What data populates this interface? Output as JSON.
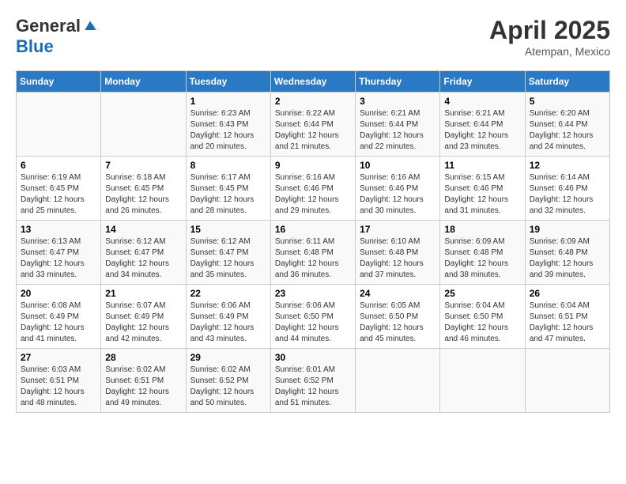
{
  "header": {
    "logo_general": "General",
    "logo_blue": "Blue",
    "month": "April 2025",
    "location": "Atempan, Mexico"
  },
  "days_of_week": [
    "Sunday",
    "Monday",
    "Tuesday",
    "Wednesday",
    "Thursday",
    "Friday",
    "Saturday"
  ],
  "weeks": [
    [
      {
        "day": "",
        "sunrise": "",
        "sunset": "",
        "daylight": ""
      },
      {
        "day": "",
        "sunrise": "",
        "sunset": "",
        "daylight": ""
      },
      {
        "day": "1",
        "sunrise": "Sunrise: 6:23 AM",
        "sunset": "Sunset: 6:43 PM",
        "daylight": "Daylight: 12 hours and 20 minutes."
      },
      {
        "day": "2",
        "sunrise": "Sunrise: 6:22 AM",
        "sunset": "Sunset: 6:44 PM",
        "daylight": "Daylight: 12 hours and 21 minutes."
      },
      {
        "day": "3",
        "sunrise": "Sunrise: 6:21 AM",
        "sunset": "Sunset: 6:44 PM",
        "daylight": "Daylight: 12 hours and 22 minutes."
      },
      {
        "day": "4",
        "sunrise": "Sunrise: 6:21 AM",
        "sunset": "Sunset: 6:44 PM",
        "daylight": "Daylight: 12 hours and 23 minutes."
      },
      {
        "day": "5",
        "sunrise": "Sunrise: 6:20 AM",
        "sunset": "Sunset: 6:44 PM",
        "daylight": "Daylight: 12 hours and 24 minutes."
      }
    ],
    [
      {
        "day": "6",
        "sunrise": "Sunrise: 6:19 AM",
        "sunset": "Sunset: 6:45 PM",
        "daylight": "Daylight: 12 hours and 25 minutes."
      },
      {
        "day": "7",
        "sunrise": "Sunrise: 6:18 AM",
        "sunset": "Sunset: 6:45 PM",
        "daylight": "Daylight: 12 hours and 26 minutes."
      },
      {
        "day": "8",
        "sunrise": "Sunrise: 6:17 AM",
        "sunset": "Sunset: 6:45 PM",
        "daylight": "Daylight: 12 hours and 28 minutes."
      },
      {
        "day": "9",
        "sunrise": "Sunrise: 6:16 AM",
        "sunset": "Sunset: 6:46 PM",
        "daylight": "Daylight: 12 hours and 29 minutes."
      },
      {
        "day": "10",
        "sunrise": "Sunrise: 6:16 AM",
        "sunset": "Sunset: 6:46 PM",
        "daylight": "Daylight: 12 hours and 30 minutes."
      },
      {
        "day": "11",
        "sunrise": "Sunrise: 6:15 AM",
        "sunset": "Sunset: 6:46 PM",
        "daylight": "Daylight: 12 hours and 31 minutes."
      },
      {
        "day": "12",
        "sunrise": "Sunrise: 6:14 AM",
        "sunset": "Sunset: 6:46 PM",
        "daylight": "Daylight: 12 hours and 32 minutes."
      }
    ],
    [
      {
        "day": "13",
        "sunrise": "Sunrise: 6:13 AM",
        "sunset": "Sunset: 6:47 PM",
        "daylight": "Daylight: 12 hours and 33 minutes."
      },
      {
        "day": "14",
        "sunrise": "Sunrise: 6:12 AM",
        "sunset": "Sunset: 6:47 PM",
        "daylight": "Daylight: 12 hours and 34 minutes."
      },
      {
        "day": "15",
        "sunrise": "Sunrise: 6:12 AM",
        "sunset": "Sunset: 6:47 PM",
        "daylight": "Daylight: 12 hours and 35 minutes."
      },
      {
        "day": "16",
        "sunrise": "Sunrise: 6:11 AM",
        "sunset": "Sunset: 6:48 PM",
        "daylight": "Daylight: 12 hours and 36 minutes."
      },
      {
        "day": "17",
        "sunrise": "Sunrise: 6:10 AM",
        "sunset": "Sunset: 6:48 PM",
        "daylight": "Daylight: 12 hours and 37 minutes."
      },
      {
        "day": "18",
        "sunrise": "Sunrise: 6:09 AM",
        "sunset": "Sunset: 6:48 PM",
        "daylight": "Daylight: 12 hours and 38 minutes."
      },
      {
        "day": "19",
        "sunrise": "Sunrise: 6:09 AM",
        "sunset": "Sunset: 6:48 PM",
        "daylight": "Daylight: 12 hours and 39 minutes."
      }
    ],
    [
      {
        "day": "20",
        "sunrise": "Sunrise: 6:08 AM",
        "sunset": "Sunset: 6:49 PM",
        "daylight": "Daylight: 12 hours and 41 minutes."
      },
      {
        "day": "21",
        "sunrise": "Sunrise: 6:07 AM",
        "sunset": "Sunset: 6:49 PM",
        "daylight": "Daylight: 12 hours and 42 minutes."
      },
      {
        "day": "22",
        "sunrise": "Sunrise: 6:06 AM",
        "sunset": "Sunset: 6:49 PM",
        "daylight": "Daylight: 12 hours and 43 minutes."
      },
      {
        "day": "23",
        "sunrise": "Sunrise: 6:06 AM",
        "sunset": "Sunset: 6:50 PM",
        "daylight": "Daylight: 12 hours and 44 minutes."
      },
      {
        "day": "24",
        "sunrise": "Sunrise: 6:05 AM",
        "sunset": "Sunset: 6:50 PM",
        "daylight": "Daylight: 12 hours and 45 minutes."
      },
      {
        "day": "25",
        "sunrise": "Sunrise: 6:04 AM",
        "sunset": "Sunset: 6:50 PM",
        "daylight": "Daylight: 12 hours and 46 minutes."
      },
      {
        "day": "26",
        "sunrise": "Sunrise: 6:04 AM",
        "sunset": "Sunset: 6:51 PM",
        "daylight": "Daylight: 12 hours and 47 minutes."
      }
    ],
    [
      {
        "day": "27",
        "sunrise": "Sunrise: 6:03 AM",
        "sunset": "Sunset: 6:51 PM",
        "daylight": "Daylight: 12 hours and 48 minutes."
      },
      {
        "day": "28",
        "sunrise": "Sunrise: 6:02 AM",
        "sunset": "Sunset: 6:51 PM",
        "daylight": "Daylight: 12 hours and 49 minutes."
      },
      {
        "day": "29",
        "sunrise": "Sunrise: 6:02 AM",
        "sunset": "Sunset: 6:52 PM",
        "daylight": "Daylight: 12 hours and 50 minutes."
      },
      {
        "day": "30",
        "sunrise": "Sunrise: 6:01 AM",
        "sunset": "Sunset: 6:52 PM",
        "daylight": "Daylight: 12 hours and 51 minutes."
      },
      {
        "day": "",
        "sunrise": "",
        "sunset": "",
        "daylight": ""
      },
      {
        "day": "",
        "sunrise": "",
        "sunset": "",
        "daylight": ""
      },
      {
        "day": "",
        "sunrise": "",
        "sunset": "",
        "daylight": ""
      }
    ]
  ]
}
